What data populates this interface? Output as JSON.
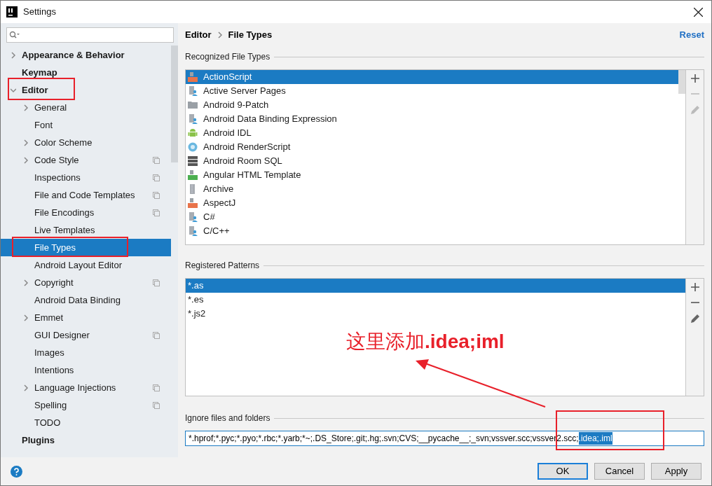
{
  "window": {
    "title": "Settings"
  },
  "sidebar": {
    "items": [
      {
        "label": "Appearance & Behavior",
        "bold": true,
        "expanded": false,
        "selected": false
      },
      {
        "label": "Keymap",
        "bold": true,
        "selected": false
      },
      {
        "label": "Editor",
        "bold": true,
        "expanded": true,
        "selected": false,
        "children": [
          {
            "label": "General",
            "expanded": false,
            "selected": false
          },
          {
            "label": "Font",
            "selected": false
          },
          {
            "label": "Color Scheme",
            "expanded": false,
            "selected": false
          },
          {
            "label": "Code Style",
            "expanded": false,
            "copy_icon": true,
            "selected": false
          },
          {
            "label": "Inspections",
            "copy_icon": true,
            "selected": false
          },
          {
            "label": "File and Code Templates",
            "copy_icon": true,
            "selected": false
          },
          {
            "label": "File Encodings",
            "copy_icon": true,
            "selected": false
          },
          {
            "label": "Live Templates",
            "selected": false
          },
          {
            "label": "File Types",
            "selected": true
          },
          {
            "label": "Android Layout Editor",
            "selected": false
          },
          {
            "label": "Copyright",
            "expanded": false,
            "copy_icon": true,
            "selected": false
          },
          {
            "label": "Android Data Binding",
            "selected": false
          },
          {
            "label": "Emmet",
            "expanded": false,
            "selected": false
          },
          {
            "label": "GUI Designer",
            "copy_icon": true,
            "selected": false
          },
          {
            "label": "Images",
            "selected": false
          },
          {
            "label": "Intentions",
            "selected": false
          },
          {
            "label": "Language Injections",
            "expanded": false,
            "copy_icon": true,
            "selected": false
          },
          {
            "label": "Spelling",
            "copy_icon": true,
            "selected": false
          },
          {
            "label": "TODO",
            "selected": false
          }
        ]
      },
      {
        "label": "Plugins",
        "bold": true,
        "selected": false
      }
    ]
  },
  "breadcrumb": [
    "Editor",
    "File Types"
  ],
  "reset": "Reset",
  "recognized": {
    "title": "Recognized File Types",
    "rows": [
      {
        "label": "ActionScript",
        "kind": "as",
        "selected": true
      },
      {
        "label": "Active Server Pages",
        "kind": "generic",
        "selected": false
      },
      {
        "label": "Android 9-Patch",
        "kind": "folder",
        "selected": false
      },
      {
        "label": "Android Data Binding Expression",
        "kind": "generic",
        "selected": false
      },
      {
        "label": "Android IDL",
        "kind": "android",
        "selected": false
      },
      {
        "label": "Android RenderScript",
        "kind": "rs",
        "selected": false
      },
      {
        "label": "Android Room SQL",
        "kind": "db",
        "selected": false
      },
      {
        "label": "Angular HTML Template",
        "kind": "html",
        "selected": false
      },
      {
        "label": "Archive",
        "kind": "archive",
        "selected": false
      },
      {
        "label": "AspectJ",
        "kind": "aj",
        "selected": false
      },
      {
        "label": "C#",
        "kind": "generic",
        "selected": false
      },
      {
        "label": "C/C++",
        "kind": "generic",
        "selected": false
      }
    ],
    "remove_disabled": true,
    "edit_disabled": true
  },
  "patterns": {
    "title": "Registered Patterns",
    "rows": [
      {
        "label": "*.as",
        "selected": true
      },
      {
        "label": "*.es",
        "selected": false
      },
      {
        "label": "*.js2",
        "selected": false
      }
    ],
    "remove_disabled": false,
    "edit_disabled": false
  },
  "ignore": {
    "label": "Ignore files and folders",
    "value": "*.hprof;*.pyc;*.pyo;*.rbc;*.yarb;*~;.DS_Store;.git;.hg;.svn;CVS;__pycache__;_svn;vssver.scc;vssver2.scc;",
    "selected_text": ".idea;.iml"
  },
  "annotation": {
    "note": "这里添加**.idea;iml**"
  },
  "buttons": [
    {
      "label": "OK",
      "default": true
    },
    {
      "label": "Cancel",
      "default": false
    },
    {
      "label": "Apply",
      "default": false
    }
  ]
}
